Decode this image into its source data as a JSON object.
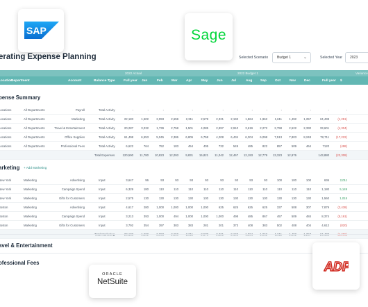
{
  "header": {
    "title": "erating Expense Planning",
    "scenario_label": "Selected Scenario",
    "scenario_value": "Budget 1",
    "year_label": "Selected Year",
    "year_value": "2023"
  },
  "bands": {
    "actual": "2022 Actual",
    "budget": "2022 Budget 1",
    "variance": "Variance"
  },
  "columns": [
    "Location",
    "Department",
    "Account",
    "Balance Type",
    "Full year",
    "Jan",
    "Feb",
    "Mar",
    "Apr",
    "May",
    "Jun",
    "Jul",
    "Aug",
    "Sep",
    "Oct",
    "Nov",
    "Dec",
    "Full year",
    "$"
  ],
  "summary": {
    "title": "pense Summary",
    "rows": [
      {
        "loc": "Locations",
        "dept": "All Departments",
        "acct": "Payroll",
        "bt": "Total Activity",
        "v": [
          "-",
          "-",
          "-",
          "-",
          "-",
          "-",
          "-",
          "-",
          "-",
          "-",
          "-",
          "-",
          "-",
          "-",
          "-"
        ]
      },
      {
        "loc": "Locations",
        "dept": "All Departments",
        "acct": "Marketing",
        "bt": "Total Activity",
        "v": [
          "22,183",
          "1,502",
          "2,093",
          "2,659",
          "2,311",
          "2,578",
          "2,321",
          "2,193",
          "1,864",
          "1,962",
          "1,611",
          "1,492",
          "1,257",
          "24,438",
          "(1,251)"
        ]
      },
      {
        "loc": "Locations",
        "dept": "All Departments",
        "acct": "Travel & Entertainment",
        "bt": "Total Activity",
        "v": [
          "20,287",
          "3,032",
          "1,739",
          "2,758",
          "1,501",
          "4,085",
          "2,997",
          "2,910",
          "3,619",
          "2,272",
          "2,798",
          "2,522",
          "2,330",
          "33,601",
          "(4,304)"
        ]
      },
      {
        "loc": "Locations",
        "dept": "All Departments",
        "acct": "Office Supplies",
        "bt": "Total Activity",
        "v": [
          "61,498",
          "6,553",
          "5,045",
          "2,386",
          "6,805",
          "6,758",
          "4,208",
          "6,434",
          "6,304",
          "6,098",
          "7,513",
          "7,803",
          "8,248",
          "78,711",
          "(17,222)"
        ]
      },
      {
        "loc": "Locations",
        "dept": "All Departments",
        "acct": "Professional Fees",
        "bt": "Total Activity",
        "v": "6,622|764|752|183|454|405|732|549|485|822|857|509|464|7120|(498)"
      }
    ],
    "total": {
      "bt": "Total Expenses",
      "v": [
        "120,590",
        "11,780",
        "10,823",
        "12,093",
        "9,831",
        "15,821",
        "11,042",
        "12,467",
        "12,193",
        "12,779",
        "13,323",
        "12,976",
        "143,880",
        "(23,308)"
      ]
    }
  },
  "marketing": {
    "title": "arketing",
    "add_label": "+ Add Marketing",
    "rows": [
      {
        "loc": "New York",
        "dept": "Marketing",
        "acct": "Advertising",
        "bt": "Input",
        "v": [
          "3,647",
          "96",
          "93",
          "93",
          "93",
          "93",
          "93",
          "93",
          "93",
          "93",
          "100",
          "100",
          "100",
          "636",
          "2,011"
        ]
      },
      {
        "loc": "New York",
        "dept": "Marketing",
        "acct": "Campaign Spend",
        "bt": "Input",
        "v": [
          "6,329",
          "180",
          "110",
          "110",
          "110",
          "110",
          "110",
          "110",
          "110",
          "110",
          "110",
          "110",
          "110",
          "1,180",
          "5,149"
        ]
      },
      {
        "loc": "New York",
        "dept": "Marketing",
        "acct": "Gifts for Customers",
        "bt": "Input",
        "v": [
          "2,575",
          "130",
          "130",
          "130",
          "130",
          "130",
          "130",
          "130",
          "130",
          "130",
          "130",
          "130",
          "130",
          "1,560",
          "1,015"
        ]
      },
      {
        "loc": "Boston",
        "dept": "Marketing",
        "acct": "Advertising",
        "bt": "Input",
        "v": [
          "4,617",
          "280",
          "1,000",
          "1,000",
          "1,000",
          "1,000",
          "625",
          "625",
          "625",
          "625",
          "337",
          "508",
          "307",
          "7,879",
          "(3,438)"
        ]
      },
      {
        "loc": "Boston",
        "dept": "Marketing",
        "acct": "Campaign Spend",
        "bt": "Input",
        "v": [
          "3,213",
          "393",
          "1,000",
          "494",
          "1,000",
          "1,000",
          "1,000",
          "498",
          "485",
          "867",
          "457",
          "509",
          "484",
          "8,374",
          "(5,161)"
        ]
      },
      {
        "loc": "Boston",
        "dept": "Marketing",
        "acct": "Gifts for Customers",
        "bt": "Input",
        "v": [
          "3,792",
          "354",
          "397",
          "383",
          "383",
          "281",
          "201",
          "373",
          "408",
          "383",
          "502",
          "408",
          "404",
          "4,612",
          "(820)"
        ]
      }
    ],
    "total": {
      "bt": "Total Marketing",
      "v": [
        "23,183",
        "1,502",
        "2,093",
        "2,659",
        "2,311",
        "2,578",
        "2,321",
        "2,193",
        "1,864",
        "1,962",
        "1,611",
        "1,492",
        "1,257",
        "24,438",
        "(1,255)"
      ]
    }
  },
  "sections": {
    "travel": "avel & Entertainment",
    "fees": "ofessional Fees"
  },
  "logos": {
    "sap": "SAP",
    "sage": "Sage",
    "oracle": "ORACLE",
    "netsuite": "NetSuite",
    "adp": "ADP",
    "sap_color": "#0a6ed1",
    "sage_color": "#00d639",
    "adp_color": "#d0271d",
    "accent": "#62b7b3"
  }
}
